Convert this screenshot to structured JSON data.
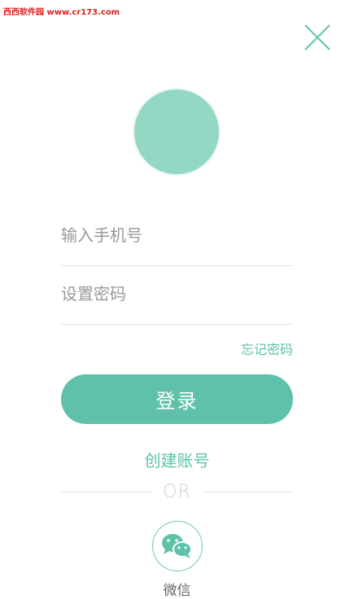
{
  "watermark": "西西软件园 www.cr173.com",
  "form": {
    "phone_placeholder": "输入手机号",
    "password_placeholder": "设置密码",
    "forgot_label": "忘记密码",
    "login_label": "登录",
    "create_label": "创建账号"
  },
  "divider": {
    "or_text": "OR"
  },
  "social": {
    "wechat_label": "微信"
  },
  "icons": {
    "close": "close-icon",
    "wechat": "wechat-icon"
  },
  "colors": {
    "accent": "#5fc1a9",
    "avatar": "#93d8c4",
    "watermark": "#e02020"
  }
}
